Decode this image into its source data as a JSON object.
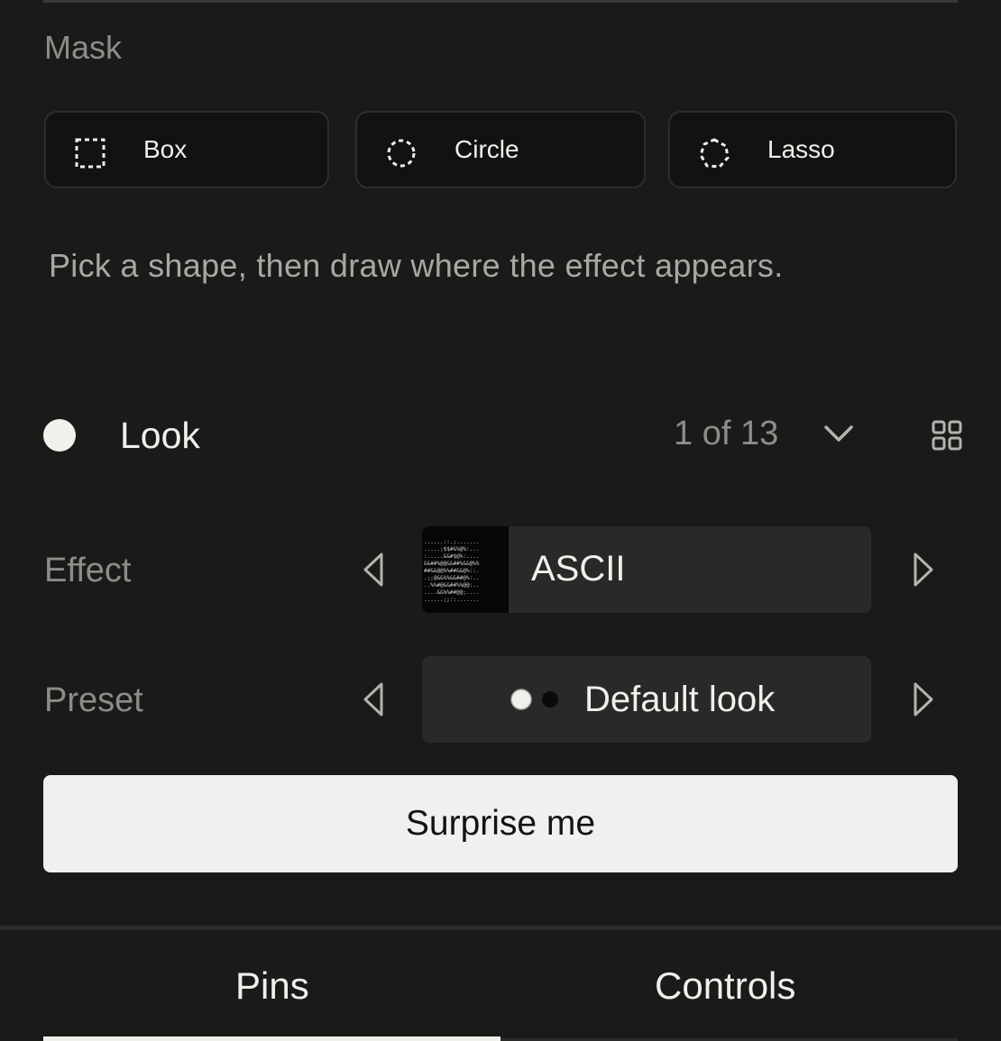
{
  "mask": {
    "section_label": "Mask",
    "options": [
      {
        "label": "Box",
        "icon": "box-select-icon"
      },
      {
        "label": "Circle",
        "icon": "circle-select-icon"
      },
      {
        "label": "Lasso",
        "icon": "lasso-select-icon"
      }
    ],
    "hint": "Pick a shape, then draw where the effect appears."
  },
  "look": {
    "title": "Look",
    "count": "1 of 13"
  },
  "effect": {
    "label": "Effect",
    "value": "ASCII"
  },
  "preset": {
    "label": "Preset",
    "value": "Default look"
  },
  "surprise_label": "Surprise me",
  "tabs": [
    {
      "label": "Pins",
      "active": true
    },
    {
      "label": "Controls",
      "active": false
    }
  ],
  "colors": {
    "background": "#1b1a19",
    "surface": "#2a2928",
    "button_light": "#f1f0ee",
    "muted_text": "#8e8c89"
  }
}
